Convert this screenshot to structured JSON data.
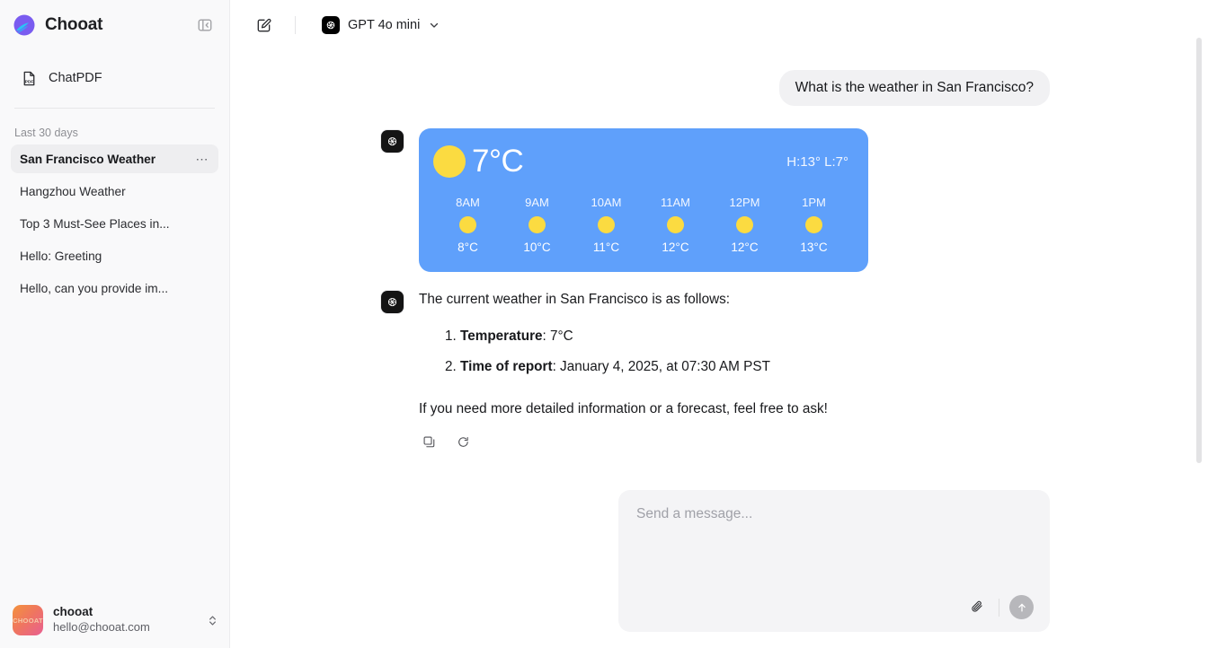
{
  "sidebar": {
    "brand": {
      "name": "Chooat",
      "logo_icon": "chooat-logo-icon"
    },
    "collapse_icon": "panel-collapse-icon",
    "nav": [
      {
        "label": "ChatPDF",
        "icon": "pdf-file-icon"
      }
    ],
    "group_label": "Last 30 days",
    "chats": [
      {
        "title": "San Francisco Weather",
        "active": true,
        "menu_icon": "more-options-icon"
      },
      {
        "title": "Hangzhou Weather",
        "active": false
      },
      {
        "title": "Top 3 Must-See Places in...",
        "active": false
      },
      {
        "title": "Hello: Greeting",
        "active": false
      },
      {
        "title": "Hello, can you provide im...",
        "active": false
      }
    ],
    "account": {
      "avatar_text": "CHOOAT",
      "name": "chooat",
      "email": "hello@chooat.com",
      "expand_icon": "chevron-up-down-icon"
    }
  },
  "topbar": {
    "new_chat_icon": "new-chat-edit-icon",
    "model_badge_icon": "openai-logo-icon",
    "model_name": "GPT 4o mini",
    "model_caret_icon": "chevron-down-icon"
  },
  "conversation": {
    "user_message": "What is the weather in San Francisco?",
    "assistant_avatar_icon": "openai-logo-icon",
    "weather_card": {
      "current_temp": "7°C",
      "high_low": "H:13° L:7°",
      "sun_icon": "sun-icon",
      "hours": [
        {
          "time": "8AM",
          "icon": "sun-icon",
          "temp": "8°C"
        },
        {
          "time": "9AM",
          "icon": "sun-icon",
          "temp": "10°C"
        },
        {
          "time": "10AM",
          "icon": "sun-icon",
          "temp": "11°C"
        },
        {
          "time": "11AM",
          "icon": "sun-icon",
          "temp": "12°C"
        },
        {
          "time": "12PM",
          "icon": "sun-icon",
          "temp": "12°C"
        },
        {
          "time": "1PM",
          "icon": "sun-icon",
          "temp": "13°C"
        }
      ]
    },
    "assistant_intro": "The current weather in San Francisco is as follows:",
    "assistant_items": [
      {
        "label": "Temperature",
        "value": ": 7°C"
      },
      {
        "label": "Time of report",
        "value": ": January 4, 2025, at 07:30 AM PST"
      }
    ],
    "assistant_outro": "If you need more detailed information or a forecast, feel free to ask!",
    "actions": [
      {
        "icon": "copy-icon"
      },
      {
        "icon": "regenerate-icon"
      }
    ]
  },
  "composer": {
    "placeholder": "Send a message...",
    "value": "",
    "attach_icon": "paperclip-icon",
    "send_icon": "send-arrow-up-icon"
  },
  "colors": {
    "weather_blue": "#5fa0fb",
    "sun_yellow": "#fbdb41",
    "sidebar_bg": "#f9f9fa",
    "bubble_bg": "#f1f1f3",
    "send_button": "#b7b7bb"
  }
}
